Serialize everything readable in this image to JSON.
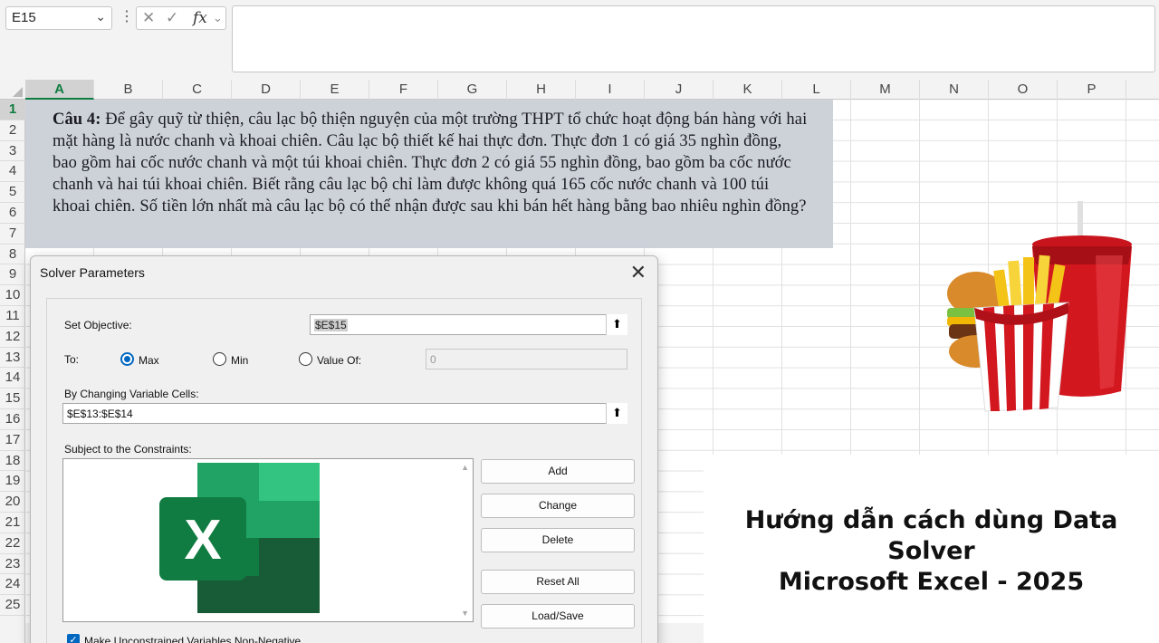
{
  "formula_bar": {
    "name_box": "E15",
    "fx_symbol": "fx",
    "cancel_icon": "x-icon",
    "enter_icon": "check-icon"
  },
  "grid": {
    "columns": [
      "A",
      "B",
      "C",
      "D",
      "E",
      "F",
      "G",
      "H",
      "I",
      "J",
      "K",
      "L",
      "M",
      "N",
      "O",
      "P"
    ],
    "rows": [
      "1",
      "2",
      "3",
      "4",
      "5",
      "6",
      "7",
      "8",
      "9",
      "10",
      "11",
      "12",
      "13",
      "14",
      "15",
      "16",
      "17",
      "18",
      "19",
      "20",
      "21",
      "22",
      "23",
      "24",
      "25"
    ],
    "selected_column": "A",
    "selected_row": "1"
  },
  "question": {
    "label": "Câu 4:",
    "text": " Để gây quỹ từ thiện, câu lạc bộ thiện nguyện của một trường THPT tổ chức hoạt động bán hàng với hai mặt hàng là nước chanh và khoai chiên. Câu lạc bộ thiết kế hai thực đơn. Thực đơn 1 có giá 35 nghìn đồng, bao gồm hai cốc nước chanh và một túi khoai chiên. Thực đơn 2 có giá 55 nghìn đồng, bao gồm ba cốc nước chanh và hai túi khoai chiên. Biết rằng câu lạc bộ chỉ làm được không quá 165 cốc nước chanh và 100 túi khoai chiên. Số tiền lớn nhất mà câu lạc bộ có thể nhận được sau khi bán hết hàng bằng bao nhiêu nghìn đồng?"
  },
  "solver": {
    "title": "Solver Parameters",
    "set_objective_label": "Set Objective:",
    "objective_value": "$E$15",
    "to_label": "To:",
    "options": {
      "max": "Max",
      "min": "Min",
      "value_of": "Value Of:"
    },
    "selected_option": "max",
    "value_of_field": "0",
    "changing_cells_label": "By Changing Variable Cells:",
    "changing_cells_value": "$E$13:$E$14",
    "constraints_label": "Subject to the Constraints:",
    "buttons": {
      "add": "Add",
      "change": "Change",
      "delete": "Delete",
      "reset_all": "Reset All",
      "load_save": "Load/Save"
    },
    "nonnegative_label": "Make Unconstrained Variables Non-Negative",
    "nonnegative_checked": true
  },
  "caption": {
    "line1": "Hướng dẫn cách dùng Data Solver",
    "line2": "Microsoft Excel - 2025"
  },
  "colors": {
    "excel_green": "#107c41",
    "accent_blue": "#0067c0"
  }
}
